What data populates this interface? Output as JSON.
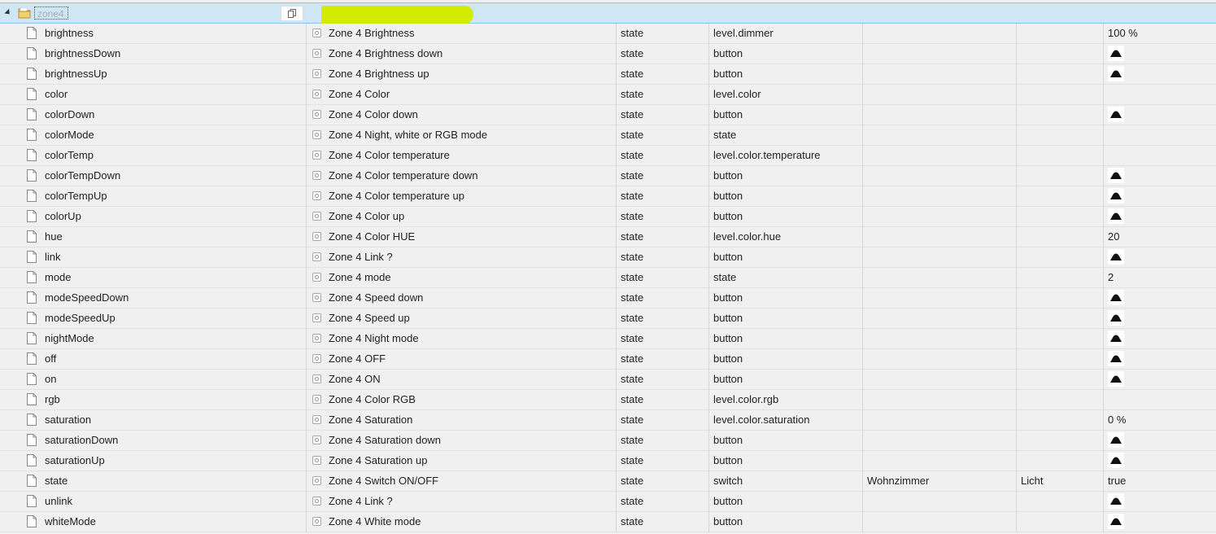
{
  "folder": {
    "name": "zone4"
  },
  "rows": [
    {
      "id": "brightness",
      "name": "Zone 4 Brightness",
      "type": "state",
      "role": "level.dimmer",
      "room": "",
      "function": "",
      "value": "100 %",
      "button": false
    },
    {
      "id": "brightnessDown",
      "name": "Zone 4 Brightness down",
      "type": "state",
      "role": "button",
      "room": "",
      "function": "",
      "value": "",
      "button": true
    },
    {
      "id": "brightnessUp",
      "name": "Zone 4 Brightness up",
      "type": "state",
      "role": "button",
      "room": "",
      "function": "",
      "value": "",
      "button": true
    },
    {
      "id": "color",
      "name": "Zone 4 Color",
      "type": "state",
      "role": "level.color",
      "room": "",
      "function": "",
      "value": "",
      "button": false
    },
    {
      "id": "colorDown",
      "name": "Zone 4 Color down",
      "type": "state",
      "role": "button",
      "room": "",
      "function": "",
      "value": "",
      "button": true
    },
    {
      "id": "colorMode",
      "name": "Zone 4 Night, white or RGB mode",
      "type": "state",
      "role": "state",
      "room": "",
      "function": "",
      "value": "",
      "button": false
    },
    {
      "id": "colorTemp",
      "name": "Zone 4 Color temperature",
      "type": "state",
      "role": "level.color.temperature",
      "room": "",
      "function": "",
      "value": "",
      "button": false
    },
    {
      "id": "colorTempDown",
      "name": "Zone 4 Color temperature down",
      "type": "state",
      "role": "button",
      "room": "",
      "function": "",
      "value": "",
      "button": true
    },
    {
      "id": "colorTempUp",
      "name": "Zone 4 Color temperature up",
      "type": "state",
      "role": "button",
      "room": "",
      "function": "",
      "value": "",
      "button": true
    },
    {
      "id": "colorUp",
      "name": "Zone 4 Color up",
      "type": "state",
      "role": "button",
      "room": "",
      "function": "",
      "value": "",
      "button": true
    },
    {
      "id": "hue",
      "name": "Zone 4 Color HUE",
      "type": "state",
      "role": "level.color.hue",
      "room": "",
      "function": "",
      "value": "20",
      "button": false
    },
    {
      "id": "link",
      "name": "Zone 4 Link ?",
      "type": "state",
      "role": "button",
      "room": "",
      "function": "",
      "value": "",
      "button": true
    },
    {
      "id": "mode",
      "name": "Zone 4 mode",
      "type": "state",
      "role": "state",
      "room": "",
      "function": "",
      "value": "2",
      "button": false
    },
    {
      "id": "modeSpeedDown",
      "name": "Zone 4 Speed down",
      "type": "state",
      "role": "button",
      "room": "",
      "function": "",
      "value": "",
      "button": true
    },
    {
      "id": "modeSpeedUp",
      "name": "Zone 4 Speed up",
      "type": "state",
      "role": "button",
      "room": "",
      "function": "",
      "value": "",
      "button": true
    },
    {
      "id": "nightMode",
      "name": "Zone 4 Night mode",
      "type": "state",
      "role": "button",
      "room": "",
      "function": "",
      "value": "",
      "button": true
    },
    {
      "id": "off",
      "name": "Zone 4 OFF",
      "type": "state",
      "role": "button",
      "room": "",
      "function": "",
      "value": "",
      "button": true
    },
    {
      "id": "on",
      "name": "Zone 4 ON",
      "type": "state",
      "role": "button",
      "room": "",
      "function": "",
      "value": "",
      "button": true
    },
    {
      "id": "rgb",
      "name": "Zone 4 Color RGB",
      "type": "state",
      "role": "level.color.rgb",
      "room": "",
      "function": "",
      "value": "",
      "button": false
    },
    {
      "id": "saturation",
      "name": "Zone 4 Saturation",
      "type": "state",
      "role": "level.color.saturation",
      "room": "",
      "function": "",
      "value": "0 %",
      "button": false
    },
    {
      "id": "saturationDown",
      "name": "Zone 4 Saturation down",
      "type": "state",
      "role": "button",
      "room": "",
      "function": "",
      "value": "",
      "button": true
    },
    {
      "id": "saturationUp",
      "name": "Zone 4 Saturation up",
      "type": "state",
      "role": "button",
      "room": "",
      "function": "",
      "value": "",
      "button": true
    },
    {
      "id": "state",
      "name": "Zone 4 Switch ON/OFF",
      "type": "state",
      "role": "switch",
      "room": "Wohnzimmer",
      "function": "Licht",
      "value": "true",
      "button": false
    },
    {
      "id": "unlink",
      "name": "Zone 4 Link ?",
      "type": "state",
      "role": "button",
      "room": "",
      "function": "",
      "value": "",
      "button": true
    },
    {
      "id": "whiteMode",
      "name": "Zone 4 White mode",
      "type": "state",
      "role": "button",
      "room": "",
      "function": "",
      "value": "",
      "button": true
    }
  ]
}
